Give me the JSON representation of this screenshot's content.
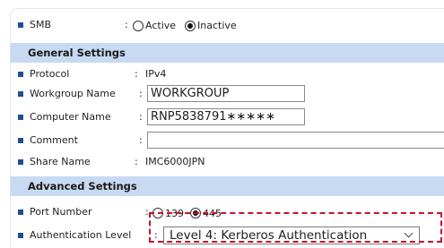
{
  "smb": {
    "label": "SMB",
    "colon": ":",
    "option_active": "Active",
    "option_inactive": "Inactive",
    "selected": "Inactive"
  },
  "general": {
    "title": "General Settings",
    "protocol_label": "Protocol",
    "protocol_value": "IPv4",
    "workgroup_label": "Workgroup Name",
    "workgroup_value": "WORKGROUP",
    "computer_label": "Computer Name",
    "computer_value": "RNP5838791∗∗∗∗∗",
    "comment_label": "Comment",
    "comment_value": "",
    "share_label": "Share Name",
    "share_value": "IMC6000JPN"
  },
  "advanced": {
    "title": "Advanced Settings",
    "port_label": "Port Number",
    "port_option_139": "139",
    "port_option_445": "445",
    "port_selected": "445",
    "auth_label": "Authentication Level",
    "auth_value": "Level 4: Kerberos Authentication"
  },
  "colors": {
    "section_bg": "#c8daf2",
    "bullet": "#1f4e96",
    "highlight": "#c8102e"
  }
}
